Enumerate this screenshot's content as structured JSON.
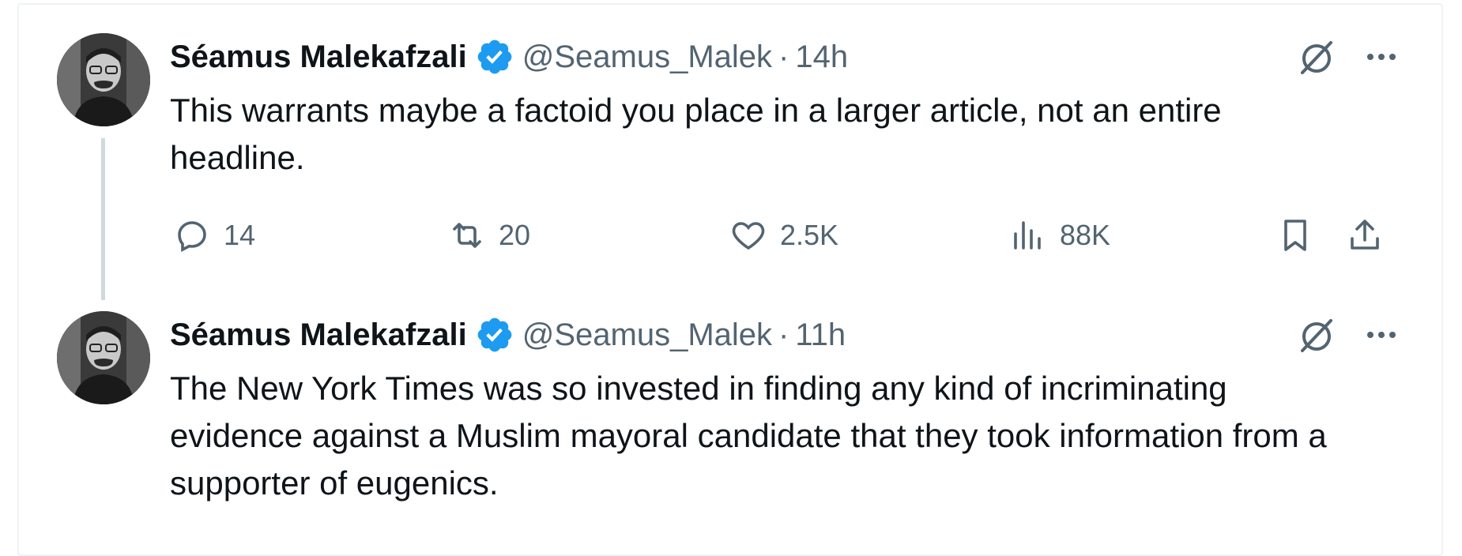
{
  "tweets": [
    {
      "author_name": "Séamus Malekafzali",
      "handle": "@Seamus_Malek",
      "separator": "·",
      "time": "14h",
      "text": "This warrants maybe a factoid you place in a larger article, not an entire headline.",
      "actions": {
        "replies": "14",
        "retweets": "20",
        "likes": "2.5K",
        "views": "88K"
      }
    },
    {
      "author_name": "Séamus Malekafzali",
      "handle": "@Seamus_Malek",
      "separator": "·",
      "time": "11h",
      "text": "The New York Times was so invested in finding any kind of incriminating evidence against a Muslim mayoral candidate that they took information from a supporter of eugenics."
    }
  ],
  "icons": {
    "verified": "verified-badge-icon",
    "grok": "grok-icon",
    "more": "more-icon",
    "reply": "reply-icon",
    "retweet": "retweet-icon",
    "like": "heart-icon",
    "views": "views-icon",
    "bookmark": "bookmark-icon",
    "share": "share-icon"
  },
  "colors": {
    "verified": "#1d9bf0",
    "text": "#0f1419",
    "secondary": "#536471",
    "thread_line": "#cfd9de"
  }
}
